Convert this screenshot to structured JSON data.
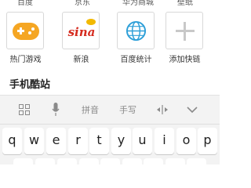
{
  "top_row": [
    "百度",
    "京东",
    "华为商城",
    "壁纸"
  ],
  "shortcuts": [
    {
      "label": "热门游戏",
      "icon": "gamepad-icon"
    },
    {
      "label": "新浪",
      "icon": "sina-logo-icon"
    },
    {
      "label": "百度统计",
      "icon": "globe-icon"
    },
    {
      "label": "添加快链",
      "icon": "plus-icon"
    }
  ],
  "logo_text": "sina",
  "site_text": "手机酷站",
  "keyboard": {
    "toolbar": {
      "pinyin": "拼音",
      "handwriting": "手写"
    },
    "row1": [
      "q",
      "w",
      "e",
      "r",
      "t",
      "y",
      "u",
      "i",
      "o",
      "p"
    ],
    "row2_partial": [
      "",
      "",
      "",
      "",
      "",
      "",
      "",
      "",
      ""
    ]
  },
  "colors": {
    "game": "#f5a623",
    "sina_red": "#d52b1e",
    "sina_eye": "#f2b900",
    "globe": "#2d9fd8"
  }
}
